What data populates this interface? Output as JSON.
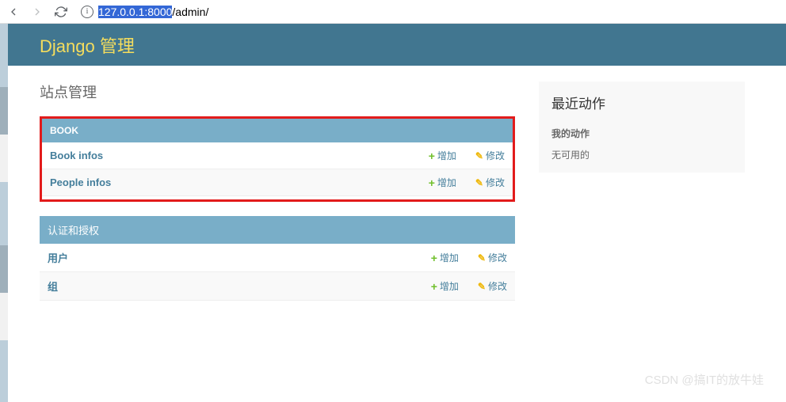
{
  "browser": {
    "url_host": "127.0.0.1:8000",
    "url_path": "/admin/"
  },
  "header": {
    "title": "Django 管理"
  },
  "page": {
    "title": "站点管理"
  },
  "modules": [
    {
      "name": "BOOK",
      "highlighted": true,
      "uppercase": true,
      "models": [
        {
          "label": "Book infos",
          "add": "增加",
          "change": "修改"
        },
        {
          "label": "People infos",
          "add": "增加",
          "change": "修改"
        }
      ]
    },
    {
      "name": "认证和授权",
      "highlighted": false,
      "uppercase": false,
      "models": [
        {
          "label": "用户",
          "add": "增加",
          "change": "修改"
        },
        {
          "label": "组",
          "add": "增加",
          "change": "修改"
        }
      ]
    }
  ],
  "sidebar": {
    "recent_title": "最近动作",
    "my_actions": "我的动作",
    "none_available": "无可用的"
  },
  "watermark": "CSDN @搞IT的放牛娃"
}
